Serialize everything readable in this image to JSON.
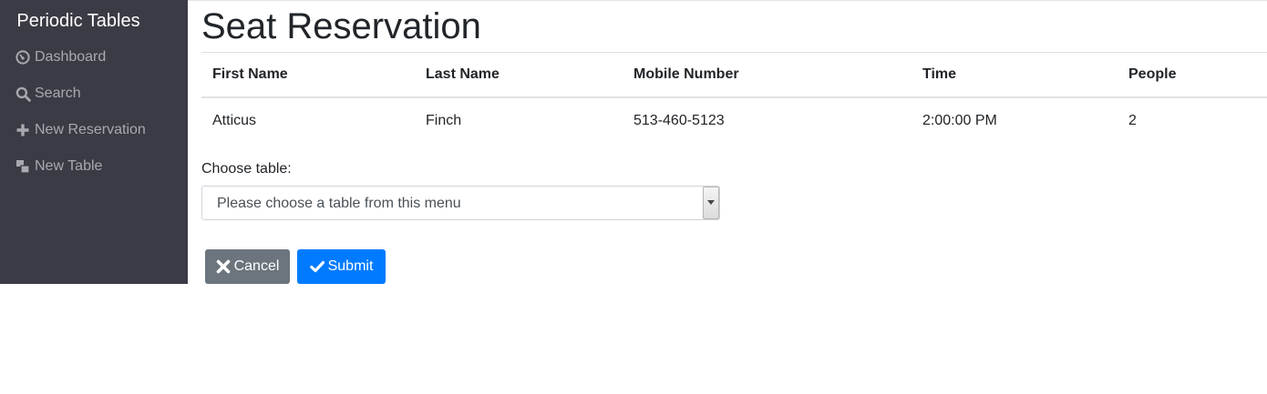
{
  "app": {
    "brand": "Periodic Tables"
  },
  "sidebar": {
    "items": [
      {
        "label": "Dashboard",
        "icon": "dashboard-icon"
      },
      {
        "label": "Search",
        "icon": "search-icon"
      },
      {
        "label": "New Reservation",
        "icon": "plus-icon"
      },
      {
        "label": "New Table",
        "icon": "tables-icon"
      }
    ]
  },
  "page": {
    "title": "Seat Reservation"
  },
  "reservation_table": {
    "columns": [
      "First Name",
      "Last Name",
      "Mobile Number",
      "Time",
      "People"
    ],
    "rows": [
      [
        "Atticus",
        "Finch",
        "513-460-5123",
        "2:00:00 PM",
        "2"
      ]
    ]
  },
  "form": {
    "label": "Choose table:",
    "select_value": "Please choose a table from this menu"
  },
  "buttons": {
    "cancel": "Cancel",
    "submit": "Submit"
  },
  "colors": {
    "sidebar_bg": "#3b3b45",
    "cancel_bg": "#6c757d",
    "submit_bg": "#007bff"
  }
}
